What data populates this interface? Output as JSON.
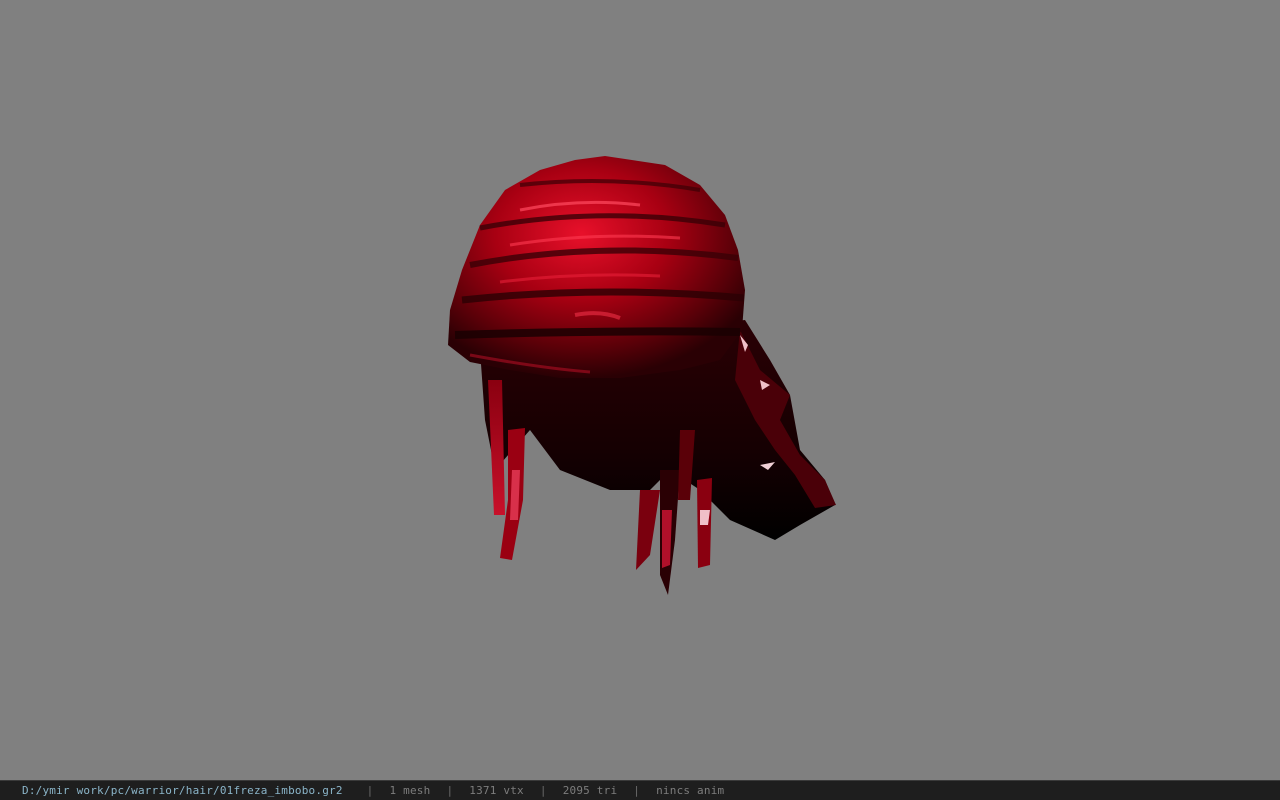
{
  "viewer": {
    "background_color": "#808080",
    "model_color": "#b00014",
    "model_icon": "hair-mesh-icon"
  },
  "status_bar": {
    "file_path": "D:/ymir work/pc/warrior/hair/01freza_imbobo.gr2",
    "separator": "|",
    "mesh_count": "1 mesh",
    "vertex_count": "1371 vtx",
    "triangle_count": "2095 tri",
    "anim_status": "nincs anim"
  }
}
